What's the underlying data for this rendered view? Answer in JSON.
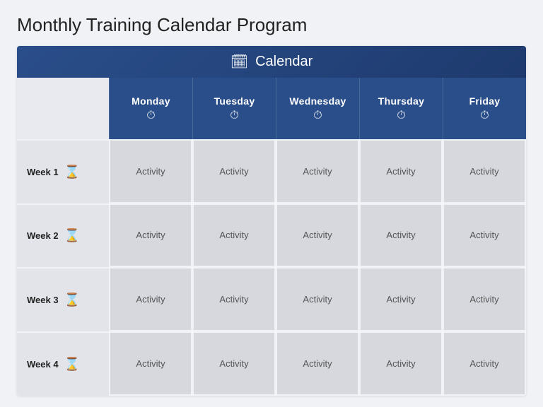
{
  "title": "Monthly Training Calendar Program",
  "calendarHeader": {
    "icon": "📅",
    "label": "Calendar"
  },
  "columns": [
    {
      "id": "monday",
      "label": "Monday",
      "icon": "⏱"
    },
    {
      "id": "tuesday",
      "label": "Tuesday",
      "icon": "⏱"
    },
    {
      "id": "wednesday",
      "label": "Wednesday",
      "icon": "⏱"
    },
    {
      "id": "thursday",
      "label": "Thursday",
      "icon": "⏱"
    },
    {
      "id": "friday",
      "label": "Friday",
      "icon": "⏱"
    }
  ],
  "rows": [
    {
      "label": "Week 1"
    },
    {
      "label": "Week 2"
    },
    {
      "label": "Week 3"
    },
    {
      "label": "Week 4"
    }
  ],
  "activityLabel": "Activity"
}
